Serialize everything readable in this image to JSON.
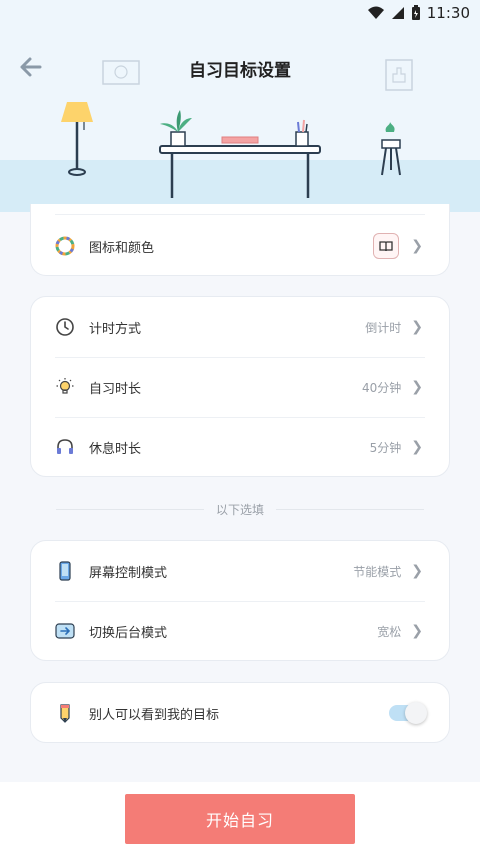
{
  "status_bar": {
    "time": "11:30"
  },
  "header": {
    "title": "自习目标设置"
  },
  "card_icon": {
    "label": "图标和颜色"
  },
  "card_timer": {
    "rows": [
      {
        "label": "计时方式",
        "value": "倒计时"
      },
      {
        "label": "自习时长",
        "value": "40分钟"
      },
      {
        "label": "休息时长",
        "value": "5分钟"
      }
    ]
  },
  "section_label": "以下选填",
  "card_mode": {
    "rows": [
      {
        "label": "屏幕控制模式",
        "value": "节能模式"
      },
      {
        "label": "切换后台模式",
        "value": "宽松"
      }
    ]
  },
  "card_visibility": {
    "label": "别人可以看到我的目标",
    "toggle_on": true
  },
  "start_button": {
    "label": "开始自习"
  },
  "colors": {
    "accent": "#f47c76",
    "header_bg": "#eef6fc",
    "floor": "#d6ecf7"
  }
}
